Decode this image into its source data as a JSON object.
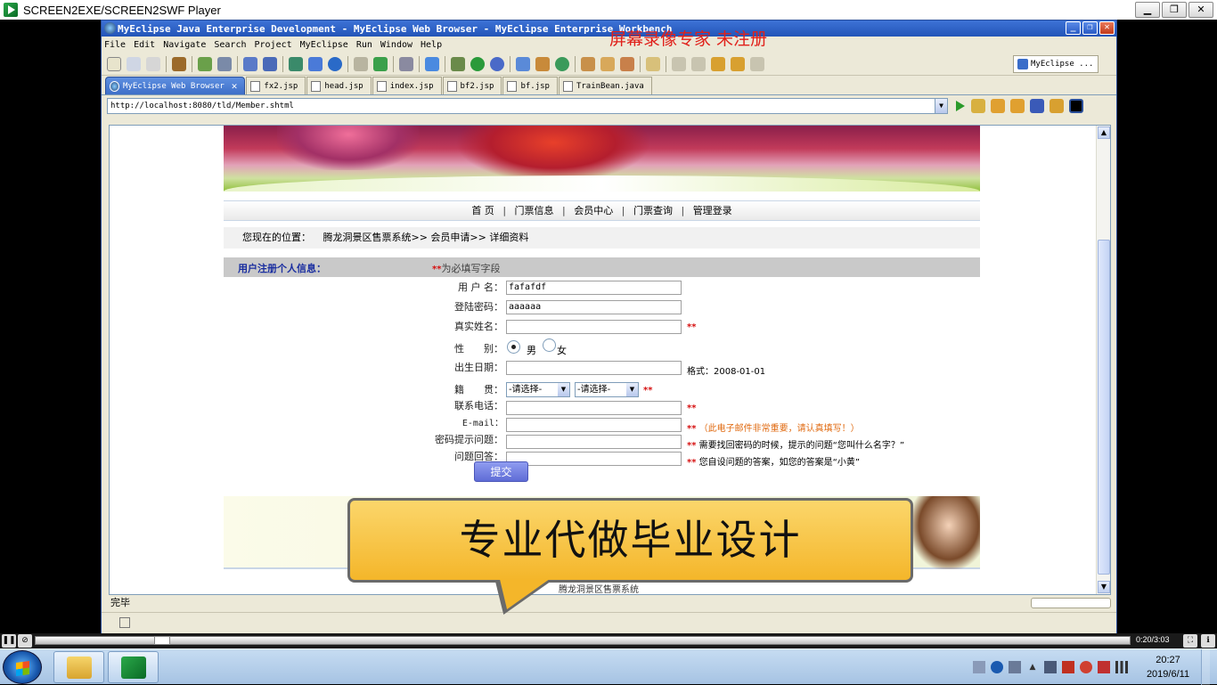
{
  "player": {
    "title": "SCREEN2EXE/SCREEN2SWF Player",
    "time": "0:20/3:03",
    "progress": 0.11
  },
  "window": {
    "title": "MyEclipse Java Enterprise Development - MyEclipse Web Browser - MyEclipse Enterprise Workbench",
    "watermark": "屏幕录像专家  未注册"
  },
  "menu": [
    "File",
    "Edit",
    "Navigate",
    "Search",
    "Project",
    "MyEclipse",
    "Run",
    "Window",
    "Help"
  ],
  "perspective": "MyEclipse ...",
  "tabs": [
    {
      "label": "MyEclipse Web Browser",
      "active": true
    },
    {
      "label": "fx2.jsp"
    },
    {
      "label": "head.jsp"
    },
    {
      "label": "index.jsp"
    },
    {
      "label": "bf2.jsp"
    },
    {
      "label": "bf.jsp"
    },
    {
      "label": "TrainBean.java"
    }
  ],
  "url": "http://localhost:8080/tld/Member.shtml",
  "nav": {
    "items": [
      "首 页",
      "门票信息",
      "会员中心",
      "门票查询",
      "管理登录"
    ],
    "sep": "|"
  },
  "breadcrumb": {
    "label": "您现在的位置：",
    "path": "腾龙洞景区售票系统>> 会员申请>> 详细资料"
  },
  "register": {
    "title": "用户注册个人信息：",
    "note_mark": "**",
    "note": "为必填写字段"
  },
  "form": {
    "req": "**",
    "username_label": "用 户 名：",
    "username_value": "fafafdf",
    "password_label": "登陆密码：",
    "password_value": "aaaaaa",
    "realname_label": "真实姓名：",
    "gender_label": "性　　别：",
    "gender_male": "男",
    "gender_female": "女",
    "birth_label": "出生日期：",
    "birth_hint": "格式：2008-01-01",
    "origin_label": "籍　　贯：",
    "select_placeholder": "-请选择-",
    "phone_label": "联系电话：",
    "email_label": "E-mail：",
    "email_hint": "（此电子邮件非常重要，请认真填写！）",
    "question_label": "密码提示问题：",
    "question_hint": "需要找回密码的时候，提示的问题“您叫什么名字？”",
    "answer_label": "问题回答：",
    "answer_hint": "您自设问题的答案，如您的答案是“小黄”",
    "submit": "提交"
  },
  "footer_text": "腾龙洞景区售票系统",
  "ad_text": "专业代做毕业设计",
  "status": "完毕",
  "clock": {
    "time": "20:27",
    "date": "2019/6/11"
  }
}
